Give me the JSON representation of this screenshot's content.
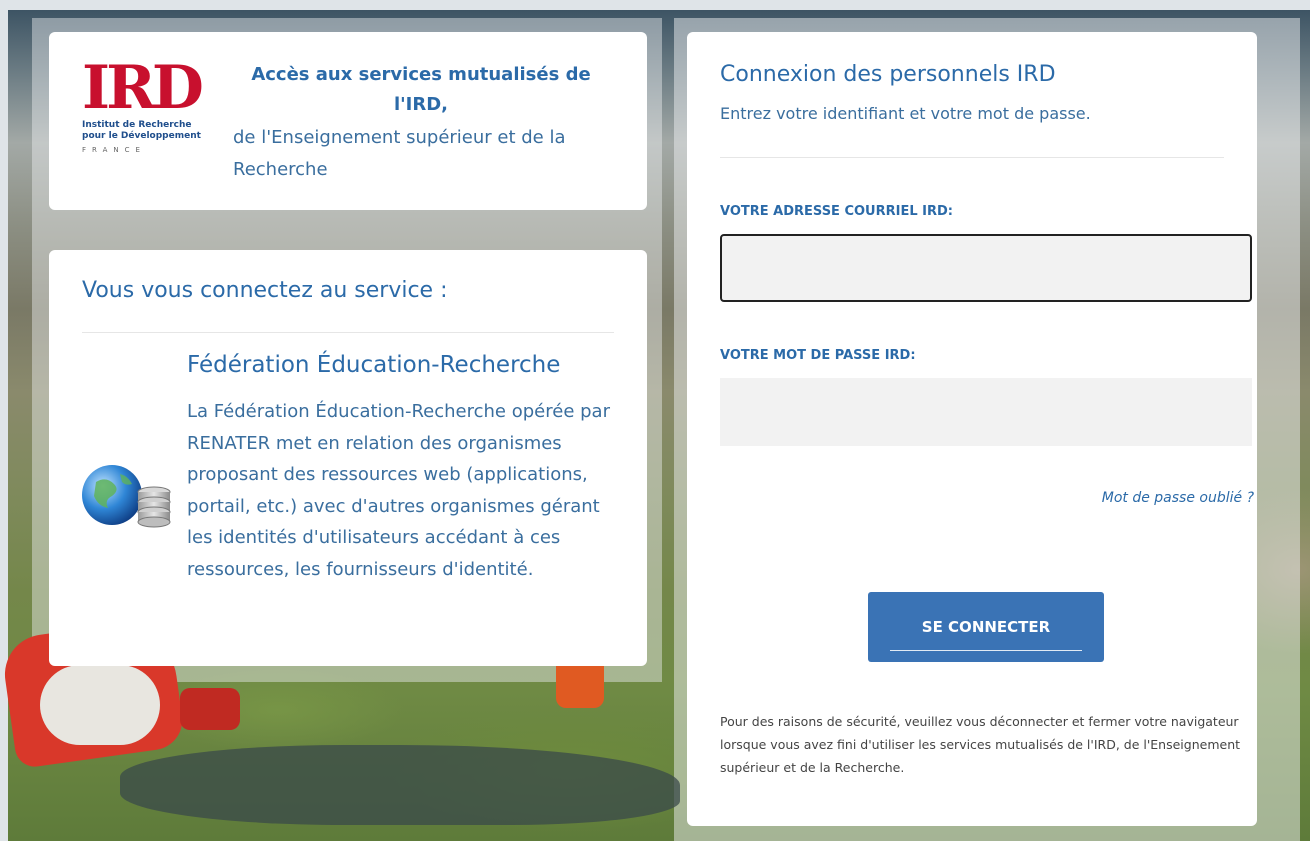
{
  "logo": {
    "mark": "IRD",
    "line1": "Institut de Recherche",
    "line2": "pour le Développement",
    "country": "FRANCE"
  },
  "header": {
    "title": "Accès aux services mutualisés de l'IRD,",
    "subtitle": "de l'Enseignement supérieur et de la Recherche"
  },
  "service": {
    "heading": "Vous vous connectez au service :",
    "name": "Fédération Éducation-Recherche",
    "description": "La Fédération Éducation-Recherche opérée par RENATER met en relation des organismes proposant des ressources web (applications, portail, etc.) avec d'autres organismes gérant les identités d'utilisateurs accédant à ces ressources, les fournisseurs d'identité.",
    "icon": "globe-database-icon"
  },
  "login": {
    "title": "Connexion des personnels IRD",
    "subtitle": "Entrez votre identifiant et votre mot de passe.",
    "email_label": "VOTRE ADRESSE COURRIEL IRD:",
    "email_value": "",
    "password_label": "VOTRE MOT DE PASSE IRD:",
    "password_value": "",
    "forgot_label": "Mot de passe oublié ?",
    "submit_label": "SE CONNECTER",
    "security_notice": "Pour des raisons de sécurité, veuillez vous déconnecter et fermer votre navigateur lorsque vous avez fini d'utiliser les services mutualisés de l'IRD, de l'Enseignement supérieur et de la Recherche."
  },
  "colors": {
    "accent": "#2b6aa8",
    "button": "#3a73b5",
    "brand_red": "#c8102e"
  }
}
